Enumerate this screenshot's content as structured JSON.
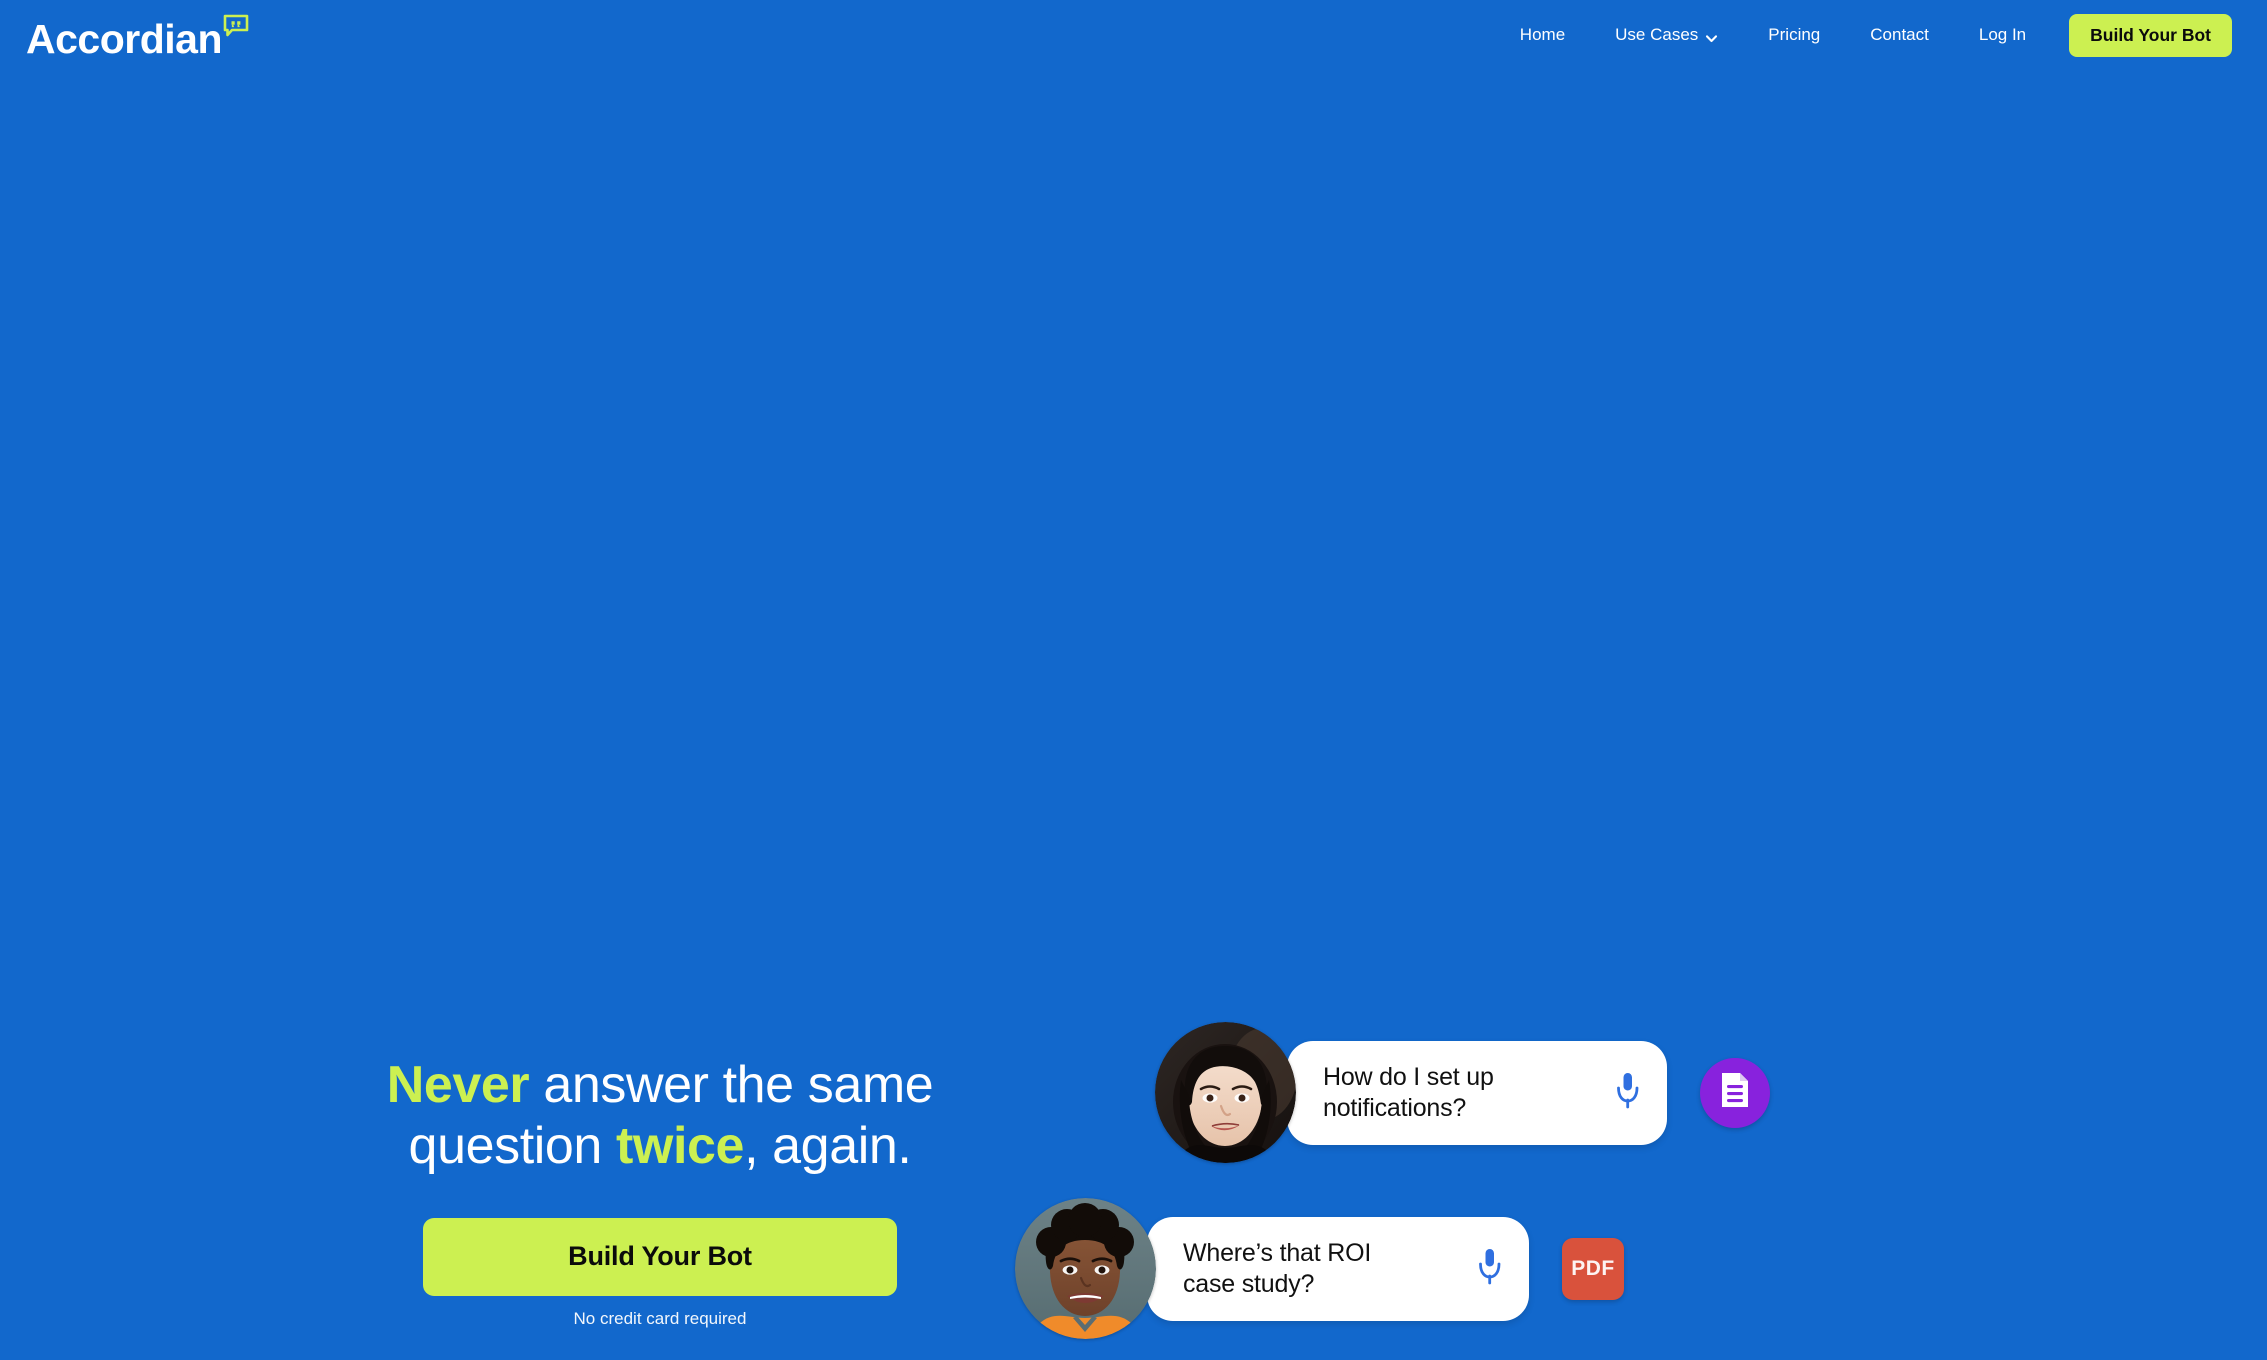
{
  "brand": {
    "name": "Accordian",
    "mark_icon": "speech-bubble-quote-icon",
    "mark_color": "#ccf051"
  },
  "colors": {
    "background": "#1268cc",
    "accent_lime": "#ccf051",
    "text_white": "#ffffff",
    "doc_purple": "#8822dd",
    "pdf_red": "#d9523c",
    "mic_blue": "#2f6fe0"
  },
  "nav": {
    "items": [
      {
        "label": "Home",
        "icon": null
      },
      {
        "label": "Use Cases",
        "icon": "chevron-down-icon"
      },
      {
        "label": "Pricing",
        "icon": null
      },
      {
        "label": "Contact",
        "icon": null
      },
      {
        "label": "Log In",
        "icon": null
      }
    ],
    "cta_label": "Build Your Bot"
  },
  "hero": {
    "headline": {
      "part1": "Never",
      "part2": " answer the same question ",
      "part3": "twice",
      "part4": ", again."
    },
    "cta_label": "Build Your Bot",
    "cta_note": "No credit card required"
  },
  "chat": {
    "messages": [
      {
        "avatar_alt": "woman-avatar-1",
        "text": "How do I set up\nnotifications?",
        "mic_icon": "microphone-icon",
        "attachment": {
          "type": "document",
          "icon": "document-icon",
          "label": ""
        }
      },
      {
        "avatar_alt": "woman-avatar-2",
        "text": "Where’s that ROI\ncase study?",
        "mic_icon": "microphone-icon",
        "attachment": {
          "type": "pdf",
          "icon": "pdf-file-icon",
          "label": "PDF"
        }
      }
    ]
  }
}
